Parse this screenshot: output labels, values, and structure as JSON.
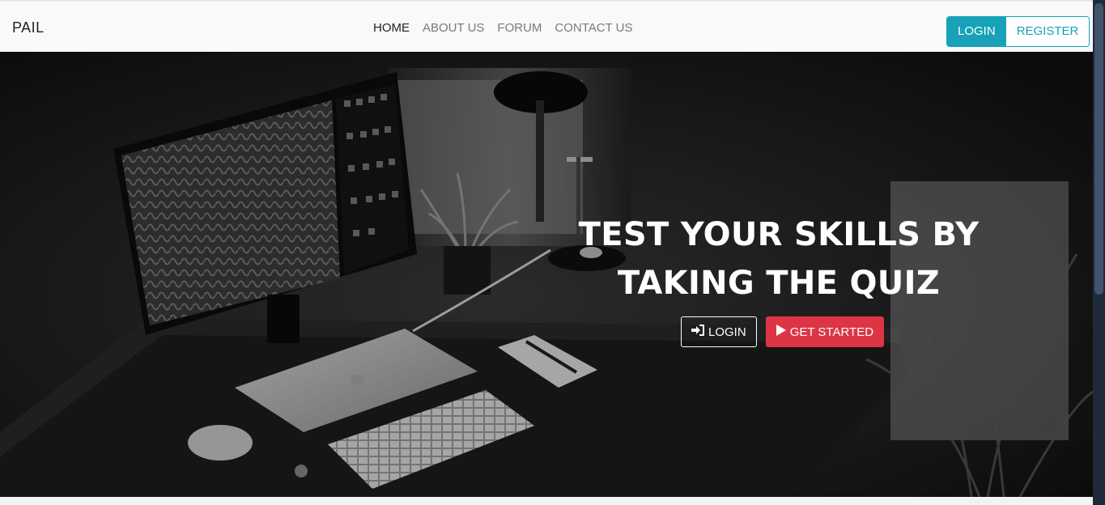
{
  "brand": "PAIL",
  "nav": {
    "items": [
      {
        "label": "HOME"
      },
      {
        "label": "ABOUT US"
      },
      {
        "label": "FORUM"
      },
      {
        "label": "CONTACT US"
      }
    ]
  },
  "auth": {
    "login_label": "LOGIN",
    "register_label": "REGISTER"
  },
  "hero": {
    "headline_line1": "TEST YOUR SKILLS BY",
    "headline_line2": "TAKING THE QUIZ",
    "login_label": "LOGIN",
    "get_started_label": "GET STARTED"
  },
  "colors": {
    "accent": "#17a2b8",
    "danger": "#dc3545",
    "navbar_bg": "#f8f9fa"
  }
}
